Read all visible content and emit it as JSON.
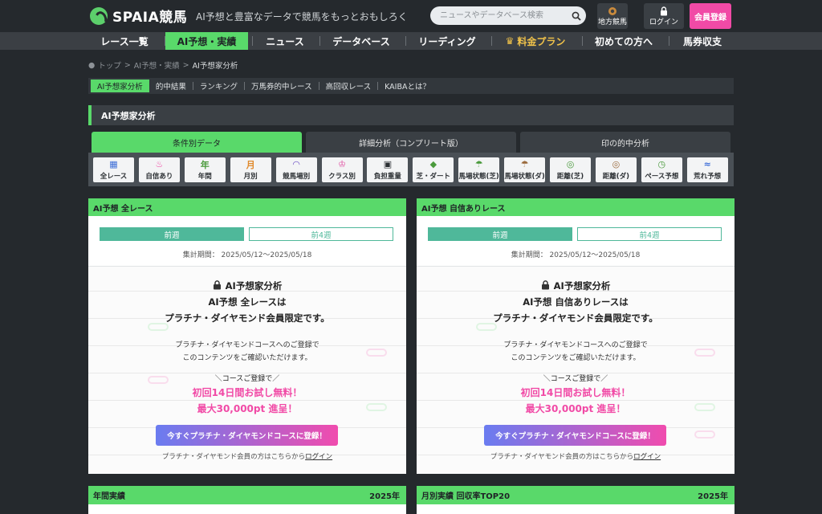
{
  "header": {
    "logo": "SPAIA競馬",
    "tagline": "AI予想と豊富なデータで競馬をもっとおもしろく",
    "search_placeholder": "ニュースやデータベース検索",
    "local_label": "地方競馬",
    "login_label": "ログイン",
    "register_label": "会員登録"
  },
  "nav": [
    "レース一覧",
    "AI予想・実績",
    "ニュース",
    "データベース",
    "リーディング",
    "料金プラン",
    "初めての方へ",
    "馬券収支"
  ],
  "breadcrumb": {
    "home": "トップ",
    "parent": "AI予想・実績",
    "current": "AI予想家分析"
  },
  "subnav": [
    "AI予想家分析",
    "的中結果",
    "ランキング",
    "万馬券的中レース",
    "高回収レース",
    "KAIBAとは？"
  ],
  "section_title": "AI予想家分析",
  "tabs": [
    "条件別データ",
    "詳細分析（コンプリート版）",
    "印の的中分析"
  ],
  "categories": [
    "全レース",
    "自信あり",
    "年間",
    "月別",
    "競馬場別",
    "クラス別",
    "負担重量",
    "芝・ダート",
    "馬場状態(芝)",
    "馬場状態(ダ)",
    "距離(芝)",
    "距離(ダ)",
    "ペース予想",
    "荒れ予想"
  ],
  "category_icons": [
    "grid-icon",
    "flame-icon",
    "year-calendar-icon",
    "month-calendar-icon",
    "racecourse-icon",
    "badge-icon",
    "weight-icon",
    "turf-dirt-icon",
    "turf-condition-icon",
    "dirt-condition-icon",
    "turf-distance-icon",
    "dirt-distance-icon",
    "pace-icon",
    "upset-icon"
  ],
  "panels": [
    {
      "title": "AI予想 全レース",
      "btn_week": "前週",
      "btn_4weeks": "前4週",
      "period": "集計期間： 2025/05/12〜2025/05/18",
      "lock_title": "AI予想家分析",
      "lock_line1": "AI予想 全レースは",
      "lock_line2": "プラチナ・ダイヤモンド会員限定です。",
      "desc1": "プラチナ・ダイヤモンドコースへのご登録で",
      "desc2": "このコンテンツをご確認いただけます。",
      "course": "＼コースご登録で／",
      "promo1": "初回14日間お試し無料！",
      "promo2": "最大30,000pt 進呈！",
      "cta": "今すぐプラチナ・ダイヤモンドコースに登録！",
      "login_pre": "プラチナ・ダイヤモンド会員の方はこちらから",
      "login_link": "ログイン"
    },
    {
      "title": "AI予想 自信ありレース",
      "btn_week": "前週",
      "btn_4weeks": "前4週",
      "period": "集計期間： 2025/05/12〜2025/05/18",
      "lock_title": "AI予想家分析",
      "lock_line1": "AI予想 自信ありレースは",
      "lock_line2": "プラチナ・ダイヤモンド会員限定です。",
      "desc1": "プラチナ・ダイヤモンドコースへのご登録で",
      "desc2": "このコンテンツをご確認いただけます。",
      "course": "＼コースご登録で／",
      "promo1": "初回14日間お試し無料！",
      "promo2": "最大30,000pt 進呈！",
      "cta": "今すぐプラチナ・ダイヤモンドコースに登録！",
      "login_pre": "プラチナ・ダイヤモンド会員の方はこちらから",
      "login_link": "ログイン"
    }
  ],
  "bottom_panels": [
    {
      "title": "年間実績",
      "year": "2025年"
    },
    {
      "title": "月別実績 回収率TOP20",
      "year": "2025年"
    }
  ],
  "colors": {
    "accent": "#59d96a",
    "pink": "#f14aa6",
    "teal": "#4fb89a",
    "bg": "#25292d"
  }
}
